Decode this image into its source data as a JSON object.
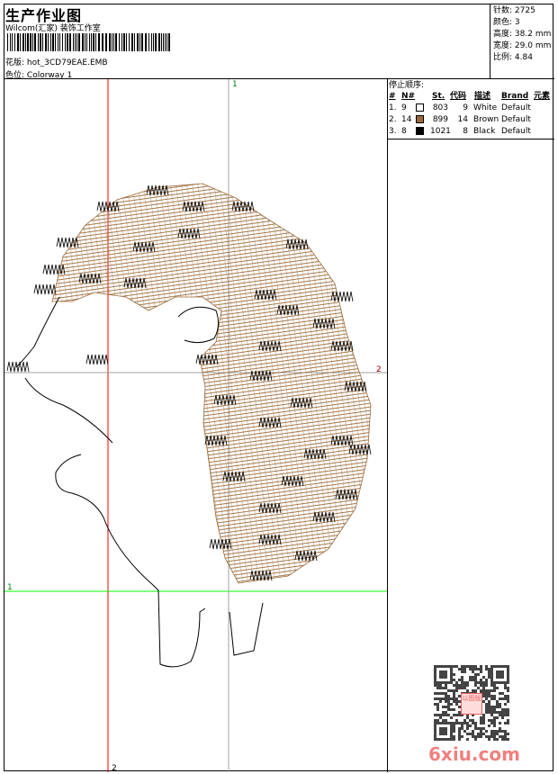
{
  "header": {
    "title": "生产作业图",
    "company": "Wilcom(汇家) 装饰工作室",
    "design_label": "花版:",
    "design_value": "hot_3CD79EAE.EMB",
    "colorway_label": "色位:",
    "colorway_value": "Colorway 1"
  },
  "info": [
    {
      "label": "针数:",
      "value": "2725"
    },
    {
      "label": "颜色:",
      "value": "3"
    },
    {
      "label": "高度:",
      "value": "38.2 mm"
    },
    {
      "label": "宽度:",
      "value": "29.0 mm"
    },
    {
      "label": "比例:",
      "value": "4.84"
    }
  ],
  "stop_sequence": {
    "title": "停止顺序:",
    "headers": [
      "#",
      "N#",
      "St.",
      "代码",
      "描述",
      "Brand",
      "元素"
    ],
    "rows": [
      {
        "idx": "1.",
        "n": "9",
        "color": "#ffffff",
        "st": "803",
        "code": "9",
        "desc": "White",
        "brand": "Default"
      },
      {
        "idx": "2.",
        "n": "14",
        "color": "#9a6a3a",
        "st": "899",
        "code": "14",
        "desc": "Brown",
        "brand": "Default"
      },
      {
        "idx": "3.",
        "n": "8",
        "color": "#000000",
        "st": "1021",
        "code": "8",
        "desc": "Black",
        "brand": "Default"
      }
    ]
  },
  "guides": {
    "v_red_label": "2",
    "h_green_label": "1",
    "v_grey_label": "1",
    "h_grey_label": "2",
    "red": "#ff0000",
    "green": "#00ff00",
    "grey": "#a0a0a0"
  },
  "watermark": {
    "text": "6xiu.com",
    "stamp": "以图版",
    "color": "#f05a5a"
  }
}
